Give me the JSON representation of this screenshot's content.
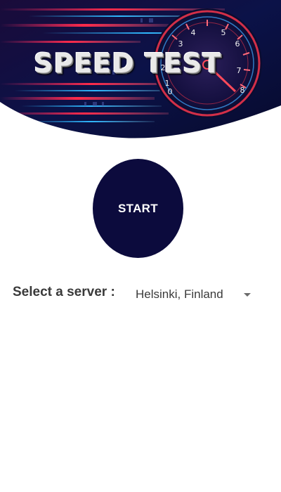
{
  "banner": {
    "title": "SPEED TEST",
    "gauge_numbers": [
      "3",
      "4",
      "5",
      "6",
      "7",
      "8",
      "2",
      "1",
      "0"
    ],
    "colors": {
      "background_dark": "#0b0f3a",
      "neon_red": "#ff2a4a",
      "neon_blue": "#2fb8ff",
      "gauge_ring": "#e8334a"
    }
  },
  "start_button": {
    "label": "START",
    "color": "#0c0b3d"
  },
  "server": {
    "label": "Select a server :",
    "selected": "Helsinki, Finland",
    "icon": "chevron-down-icon"
  }
}
